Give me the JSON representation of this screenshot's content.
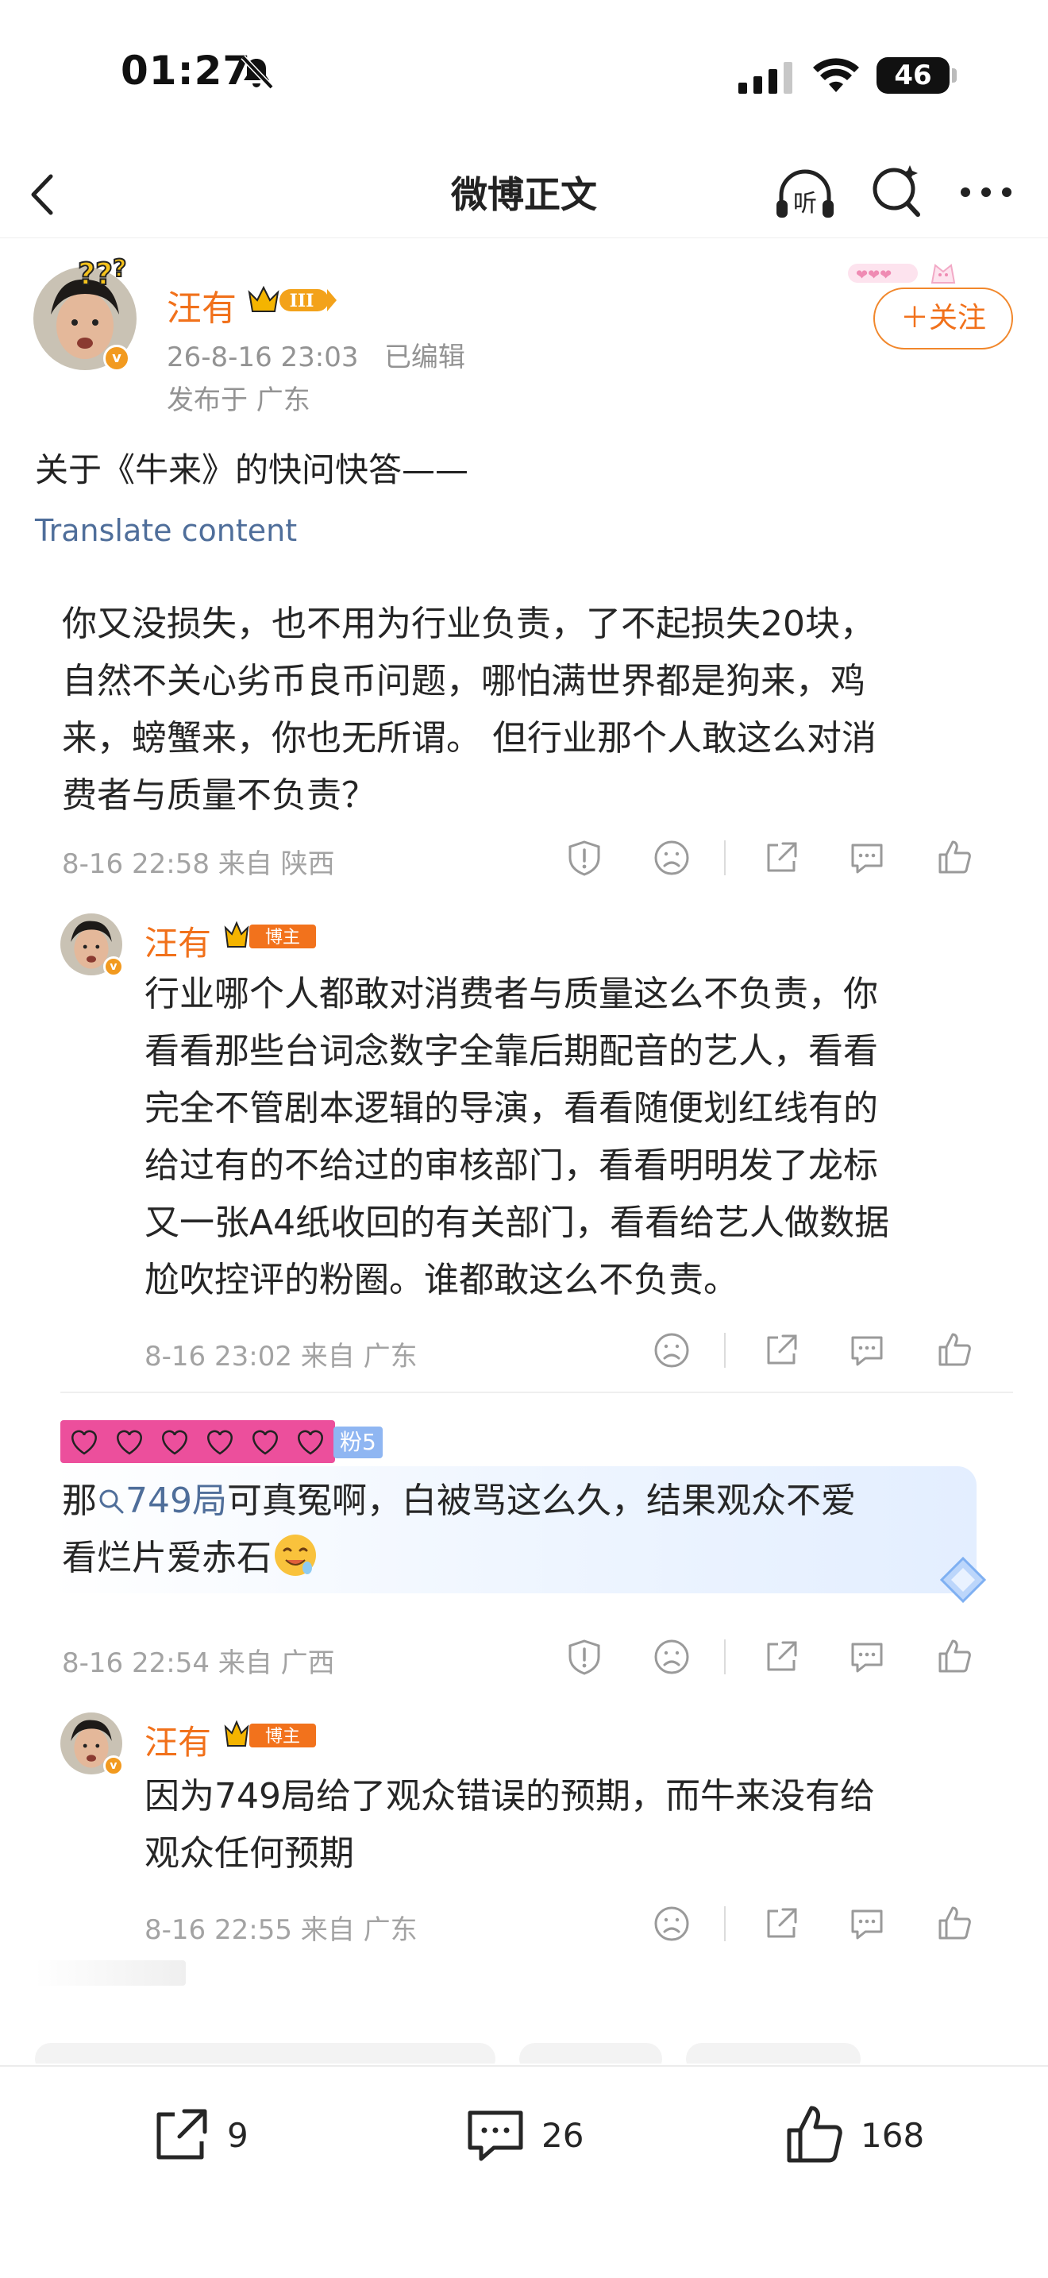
{
  "status_bar": {
    "time": "01:27",
    "battery": "46",
    "icons": [
      "bell-muted-icon",
      "signal-icon",
      "wifi-icon",
      "battery-icon"
    ]
  },
  "nav": {
    "title": "微博正文",
    "icons": [
      "back-icon",
      "listen-icon",
      "super-search-icon",
      "more-icon"
    ]
  },
  "post": {
    "author": "汪有",
    "vip_level": "III",
    "time": "26-8-16 23:03",
    "edited": "已编辑",
    "location": "发布于 广东",
    "follow_label": "＋关注",
    "text": "关于《牛来》的快问快答——",
    "translate": "Translate content"
  },
  "comments": [
    {
      "lines": [
        "你又没损失，也不用为行业负责，了不起损失20块，",
        "自然不关心劣币良币问题，哪怕满世界都是狗来，鸡",
        "来，螃蟹来，你也无所谓。 但行业那个人敢这么对消",
        "费者与质量不负责？"
      ],
      "meta": "8-16 22:58  来自 陕西",
      "reply": {
        "author": "汪有",
        "badge": "博主",
        "lines": [
          "行业哪个人都敢对消费者与质量这么不负责，你",
          "看看那些台词念数字全靠后期配音的艺人，看看",
          "完全不管剧本逻辑的导演，看看随便划红线有的",
          "给过有的不给过的审核部门，看看明明发了龙标",
          "又一张A4纸收回的有关部门，看看给艺人做数据",
          "尬吹控评的粉圈。谁都敢这么不负责。"
        ],
        "meta": "8-16 23:02  来自 广东"
      }
    },
    {
      "fan_level": "粉5",
      "line1_prefix": "那",
      "link": "749局",
      "line1_suffix": "可真冤啊，白被骂这么久，结果观众不爱",
      "line2": "看烂片爱赤石",
      "meta": "8-16 22:54  来自 广西",
      "reply": {
        "author": "汪有",
        "badge": "博主",
        "lines": [
          "因为749局给了观众错误的预期，而牛来没有给",
          "观众任何预期"
        ],
        "meta": "8-16 22:55  来自 广东"
      }
    }
  ],
  "bottom_bar": {
    "share_count": "9",
    "comment_count": "26",
    "like_count": "168"
  },
  "colors": {
    "accent_orange": "#f1711b",
    "link_blue": "#4f6e9a",
    "meta_gray": "#a3a3a3",
    "fan_pink": "#ec4f9c"
  }
}
